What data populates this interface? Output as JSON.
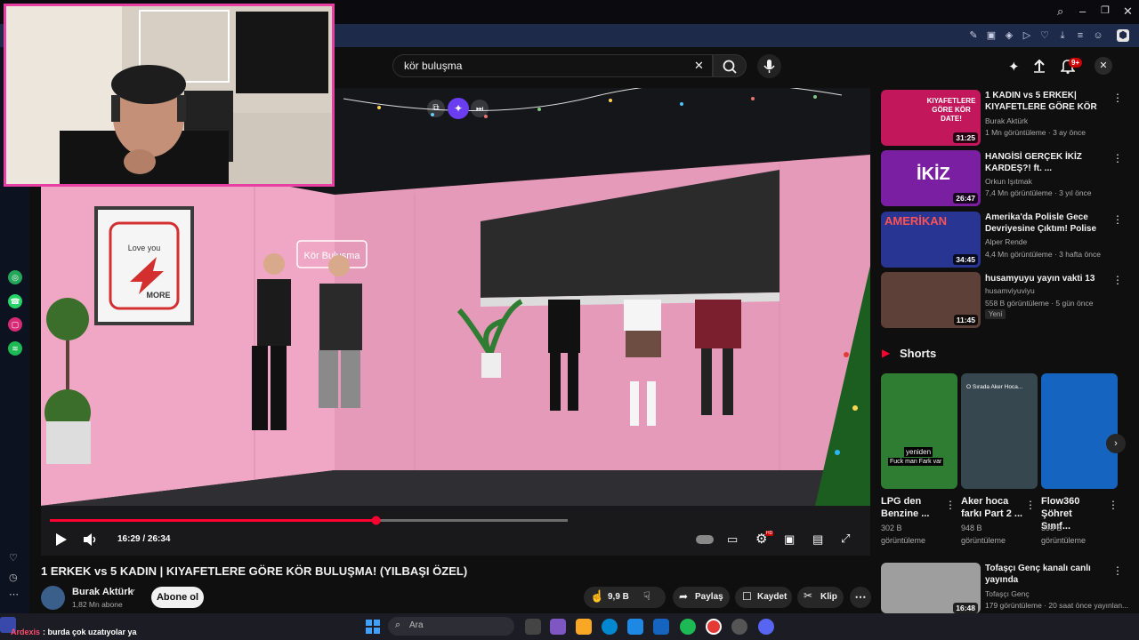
{
  "search": {
    "value": "kör buluşma"
  },
  "video": {
    "title": "1 ERKEK vs 5 KADIN | KIYAFETLERE GÖRE KÖR BULUŞMA! (YILBAŞI ÖZEL)",
    "time": "16:29 / 26:34",
    "progress": 0.63,
    "channel": "Burak Aktürk",
    "subscribers": "1,82 Mn abone",
    "subscribe_label": "Abone ol",
    "likes": "9,9 B",
    "share_label": "Paylaş",
    "save_label": "Kaydet",
    "clip_label": "Klip",
    "scene_sign": "Kör Buluşma",
    "poster_text1": "Love you",
    "poster_text2": "MORE"
  },
  "notifications": {
    "badge": "9+"
  },
  "recommendations": [
    {
      "title": "1 KADIN vs 5 ERKEK| KIYAFETLERE GÖRE KÖR ...",
      "channel": "Burak Aktürk",
      "meta": "1 Mn görüntüleme · 3 ay önce",
      "duration": "31:25",
      "thumb_text": "KIYAFETLERE GÖRE KÖR DATE!",
      "color": "#c2185b"
    },
    {
      "title": "HANGİSİ GERÇEK İKİZ KARDEŞ?! ft. ...",
      "channel": "Orkun Işıtmak",
      "meta": "7,4 Mn görüntüleme · 3 yıl önce",
      "duration": "26:47",
      "thumb_text": "İKİZ",
      "color": "#7b1fa2"
    },
    {
      "title": "Amerika'da Polisle Gece Devriyesine Çıktım! Polise Küf...",
      "channel": "Alper Rende",
      "meta": "4,4 Mn görüntüleme · 3 hafta önce",
      "duration": "34:45",
      "thumb_text": "AMERİKAN",
      "color": "#283593"
    },
    {
      "title": "husamyuyu yayın vakti 13",
      "channel": "husamviyuviyu",
      "meta": "558 B görüntüleme · 5 gün önce",
      "duration": "11:45",
      "badge": "Yeni",
      "color": "#5d4037"
    },
    {
      "title": "Tofaşçı Genç kanalı canlı yayında",
      "channel": "Tofaşçı Genç",
      "meta": "179 görüntüleme · 20 saat önce yayınlan...",
      "duration": "16:48",
      "color": "#9e9e9e"
    }
  ],
  "shorts": {
    "heading": "Shorts",
    "items": [
      {
        "title": "LPG den Benzine ...",
        "views": "302 B",
        "views_label": "görüntüleme",
        "caption": "yeniden",
        "caption2": "Fuck man Fark var",
        "color": "#2e7d32"
      },
      {
        "title": "Aker hoca farkı Part 2 ...",
        "views": "948 B",
        "views_label": "görüntüleme",
        "caption": "O Sırada Aker Hoca...",
        "color": "#37474f"
      },
      {
        "title": "Flow360 Şöhret Sınıf...",
        "views": "398 B",
        "views_label": "görüntüleme",
        "color": "#1565c0"
      }
    ]
  },
  "chat": {
    "user": "Ardexis",
    "message": ": burda çok uzatıyolar ya"
  },
  "taskbar": {
    "search_placeholder": "Ara"
  },
  "colors": {
    "accent_red": "#ff0033",
    "webcam_border": "#e83fa3",
    "tab_bar": "#1e2a4a"
  }
}
